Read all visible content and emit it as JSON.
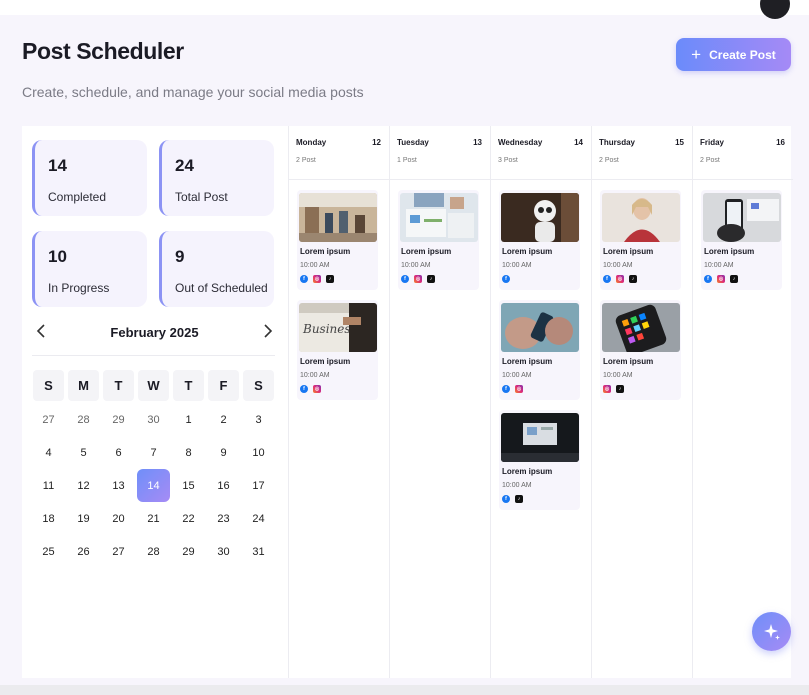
{
  "header": {
    "title": "Post Scheduler",
    "subtitle": "Create, schedule, and manage your social media posts",
    "create_button": "Create Post"
  },
  "stats": [
    {
      "value": "14",
      "label": "Completed"
    },
    {
      "value": "24",
      "label": "Total Post"
    },
    {
      "value": "10",
      "label": "In Progress"
    },
    {
      "value": "9",
      "label": "Out of Scheduled"
    }
  ],
  "calendar": {
    "month": "February 2025",
    "weekdays": [
      "S",
      "M",
      "T",
      "W",
      "T",
      "F",
      "S"
    ],
    "weeks": [
      [
        "27",
        "28",
        "29",
        "30",
        "1",
        "2",
        "3"
      ],
      [
        "4",
        "5",
        "6",
        "7",
        "8",
        "9",
        "10"
      ],
      [
        "11",
        "12",
        "13",
        "14",
        "15",
        "16",
        "17"
      ],
      [
        "18",
        "19",
        "20",
        "21",
        "22",
        "23",
        "24"
      ],
      [
        "25",
        "26",
        "27",
        "28",
        "29",
        "30",
        "31"
      ]
    ],
    "selected": "14"
  },
  "week": [
    {
      "day": "Monday",
      "date": "12",
      "count": "2 Post",
      "posts": [
        {
          "title": "Lorem ipsum",
          "time": "10:00 AM",
          "platforms": [
            "facebook",
            "instagram",
            "tiktok"
          ],
          "image": "office-team"
        },
        {
          "title": "Lorem ipsum",
          "time": "10:00 AM",
          "platforms": [
            "facebook",
            "instagram"
          ],
          "image": "business-newspaper"
        }
      ]
    },
    {
      "day": "Tuesday",
      "date": "13",
      "count": "1 Post",
      "posts": [
        {
          "title": "Lorem ipsum",
          "time": "10:00 AM",
          "platforms": [
            "facebook",
            "instagram",
            "tiktok"
          ],
          "image": "charts-desk"
        }
      ]
    },
    {
      "day": "Wednesday",
      "date": "14",
      "count": "3 Post",
      "posts": [
        {
          "title": "Lorem ipsum",
          "time": "10:00 AM",
          "platforms": [
            "facebook"
          ],
          "image": "robot"
        },
        {
          "title": "Lorem ipsum",
          "time": "10:00 AM",
          "platforms": [
            "facebook",
            "instagram"
          ],
          "image": "phone-hands"
        },
        {
          "title": "Lorem ipsum",
          "time": "10:00 AM",
          "platforms": [
            "facebook",
            "tiktok"
          ],
          "image": "presentation-screen"
        }
      ]
    },
    {
      "day": "Thursday",
      "date": "15",
      "count": "2 Post",
      "posts": [
        {
          "title": "Lorem ipsum",
          "time": "10:00 AM",
          "platforms": [
            "facebook",
            "instagram",
            "tiktok"
          ],
          "image": "woman-portrait"
        },
        {
          "title": "Lorem ipsum",
          "time": "10:00 AM",
          "platforms": [
            "instagram",
            "tiktok"
          ],
          "image": "smartphone-apps"
        }
      ]
    },
    {
      "day": "Friday",
      "date": "16",
      "count": "2 Post",
      "posts": [
        {
          "title": "Lorem ipsum",
          "time": "10:00 AM",
          "platforms": [
            "facebook",
            "instagram",
            "tiktok"
          ],
          "image": "phone-laptop"
        }
      ]
    }
  ],
  "icons": {
    "create": "plus-icon",
    "prev": "chevron-left-icon",
    "next": "chevron-right-icon",
    "fab": "sparkle-icon"
  },
  "colors": {
    "accent_start": "#6b8bfa",
    "accent_end": "#a58af6",
    "facebook": "#1877f2",
    "tiktok": "#111111"
  }
}
